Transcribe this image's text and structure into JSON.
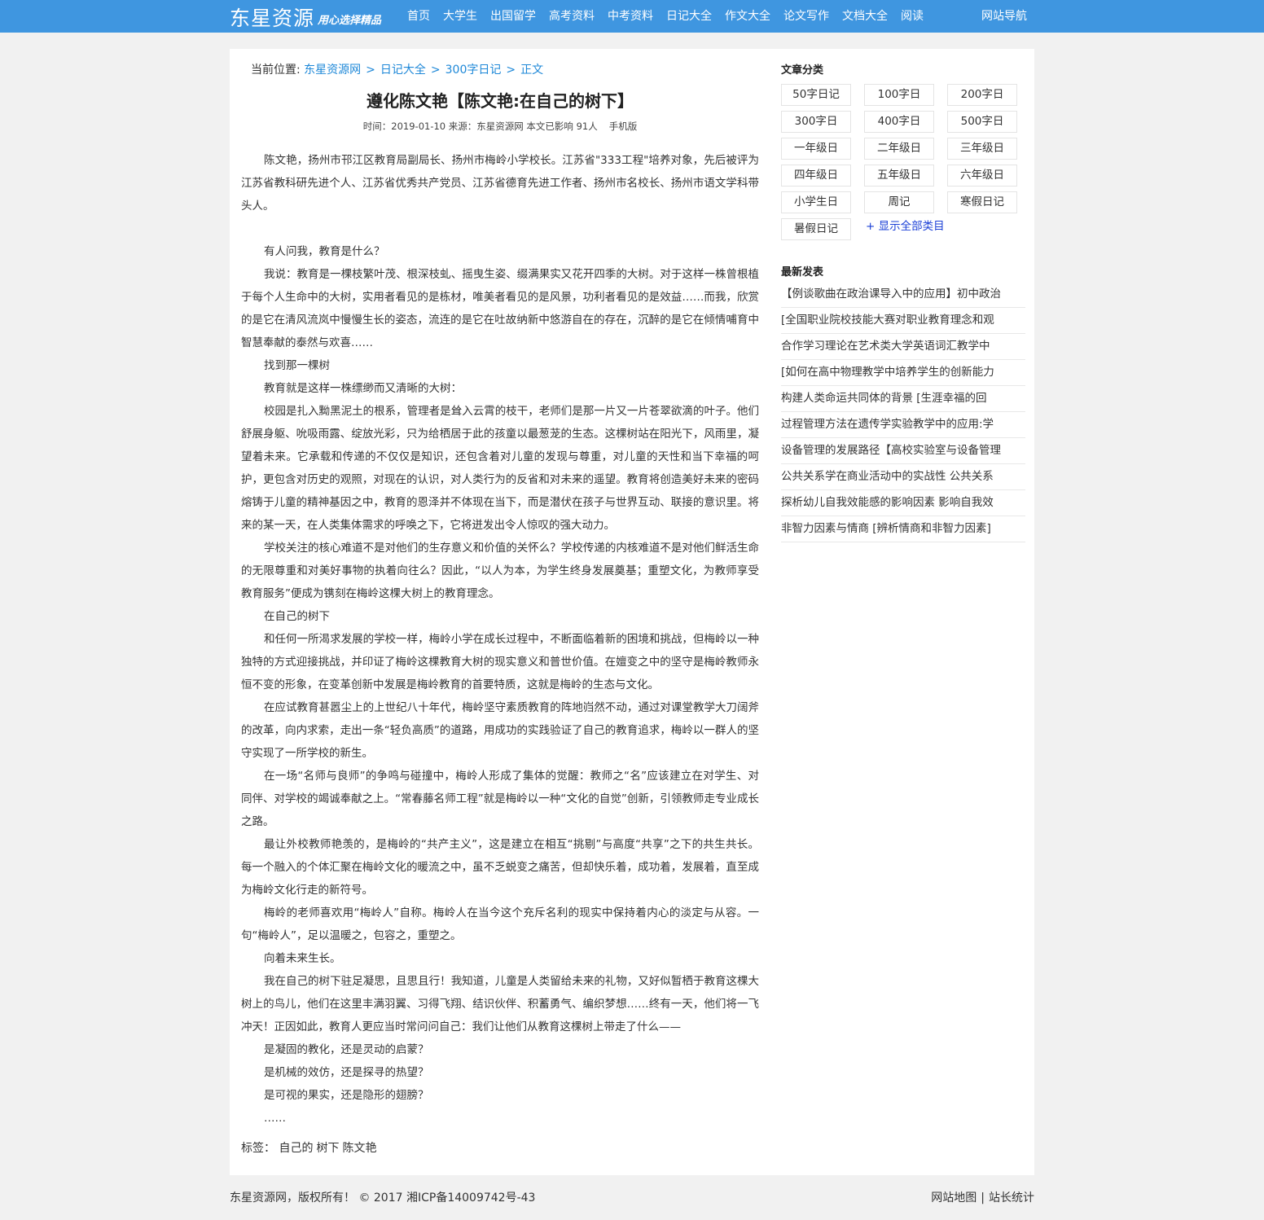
{
  "header": {
    "logo": "东星资源",
    "slogan": "用心选择精品",
    "nav": [
      "首页",
      "大学生",
      "出国留学",
      "高考资料",
      "中考资料",
      "日记大全",
      "作文大全",
      "论文写作",
      "文档大全",
      "阅读"
    ],
    "site_nav": "网站导航"
  },
  "breadcrumb": {
    "prefix": "当前位置:",
    "items": [
      "东星资源网",
      "日记大全",
      "300字日记",
      "正文"
    ],
    "separator": ">"
  },
  "article": {
    "title": "遵化陈文艳【陈文艳:在自己的树下】",
    "meta": "时间：2019-01-10 来源：东星资源网 本文已影响  91人",
    "mobile_link": "手机版",
    "paragraphs": [
      "陈文艳，扬州市邗江区教育局副局长、扬州市梅岭小学校长。江苏省\"333工程\"培养对象，先后被评为江苏省教科研先进个人、江苏省优秀共产党员、江苏省德育先进工作者、扬州市名校长、扬州市语文学科带头人。",
      "",
      "有人问我，教育是什么？",
      "我说：教育是一棵枝繁叶茂、根深枝虬、摇曳生姿、缀满果实又花开四季的大树。对于这样一株曾根植于每个人生命中的大树，实用者看见的是栋材，唯美者看见的是风景，功利者看见的是效益……而我，欣赏的是它在清风流岚中慢慢生长的姿态，流连的是它在吐故纳新中悠游自在的存在，沉醉的是它在倾情哺育中智慧奉献的泰然与欢喜……",
      "找到那一棵树",
      "教育就是这样一株缥缈而又清晰的大树：",
      "校园是扎入黝黑泥土的根系，管理者是耸入云霄的枝干，老师们是那一片又一片苍翠欲滴的叶子。他们舒展身躯、吮吸雨露、绽放光彩，只为给栖居于此的孩童以最葱茏的生态。这棵树站在阳光下，风雨里，凝望着未来。它承载和传递的不仅仅是知识，还包含着对儿童的发现与尊重，对儿童的天性和当下幸福的呵护，更包含对历史的观照，对现在的认识，对人类行为的反省和对未来的遥望。教育将创造美好未来的密码熔铸于儿童的精神基因之中，教育的恩泽并不体现在当下，而是潜伏在孩子与世界互动、联接的意识里。将来的某一天，在人类集体需求的呼唤之下，它将迸发出令人惊叹的强大动力。",
      "学校关注的核心难道不是对他们的生存意义和价值的关怀么？学校传递的内核难道不是对他们鲜活生命的无限尊重和对美好事物的执着向往么？因此，“以人为本，为学生终身发展奠基；重塑文化，为教师享受教育服务”便成为镌刻在梅岭这棵大树上的教育理念。",
      "在自己的树下",
      "和任何一所渴求发展的学校一样，梅岭小学在成长过程中，不断面临着新的困境和挑战，但梅岭以一种独特的方式迎接挑战，并印证了梅岭这棵教育大树的现实意义和普世价值。在嬗变之中的坚守是梅岭教师永恒不变的形象，在变革创新中发展是梅岭教育的首要特质，这就是梅岭的生态与文化。",
      "在应试教育甚嚣尘上的上世纪八十年代，梅岭坚守素质教育的阵地岿然不动，通过对课堂教学大刀阔斧的改革，向内求索，走出一条“轻负高质”的道路，用成功的实践验证了自己的教育追求，梅岭以一群人的坚守实现了一所学校的新生。",
      "在一场“名师与良师”的争鸣与碰撞中，梅岭人形成了集体的觉醒：教师之“名”应该建立在对学生、对同伴、对学校的竭诚奉献之上。“常春藤名师工程”就是梅岭以一种“文化的自觉”创新，引领教师走专业成长之路。",
      "最让外校教师艳羡的，是梅岭的“共产主义”，这是建立在相互“挑剔”与高度“共享”之下的共生共长。每一个融入的个体汇聚在梅岭文化的暖流之中，虽不乏蜕变之痛苦，但却快乐着，成功着，发展着，直至成为梅岭文化行走的新符号。",
      "梅岭的老师喜欢用“梅岭人”自称。梅岭人在当今这个充斥名利的现实中保持着内心的淡定与从容。一句“梅岭人”，足以温暖之，包容之，重塑之。",
      "向着未来生长。",
      "我在自己的树下驻足凝思，且思且行！我知道，儿童是人类留给未来的礼物，又好似暂栖于教育这棵大树上的鸟儿，他们在这里丰满羽翼、习得飞翔、结识伙伴、积蓄勇气、编织梦想……终有一天，他们将一飞冲天！正因如此，教育人更应当时常问问自己：我们让他们从教育这棵树上带走了什么——",
      "是凝固的教化，还是灵动的启蒙？",
      "是机械的效仿，还是探寻的热望？",
      "是可视的果实，还是隐形的翅膀？",
      "……"
    ],
    "tags_label": "标签：",
    "tags": [
      "自己的",
      "树下",
      "陈文艳"
    ]
  },
  "sidebar": {
    "category_title": "文章分类",
    "categories": [
      "50字日记",
      "100字日",
      "200字日",
      "300字日",
      "400字日",
      "500字日",
      "一年级日",
      "二年级日",
      "三年级日",
      "四年级日",
      "五年级日",
      "六年级日",
      "小学生日",
      "周记",
      "寒假日记",
      "暑假日记"
    ],
    "show_all": "+ 显示全部类目",
    "latest_title": "最新发表",
    "latest": [
      "【例谈歌曲在政治课导入中的应用】初中政治",
      "[全国职业院校技能大赛对职业教育理念和观",
      "合作学习理论在艺术类大学英语词汇教学中",
      "[如何在高中物理教学中培养学生的创新能力",
      "构建人类命运共同体的背景 [生涯幸福的回",
      "过程管理方法在遗传学实验教学中的应用:学",
      "设备管理的发展路径【高校实验室与设备管理",
      "公共关系学在商业活动中的实战性 公共关系",
      "探析幼儿自我效能感的影响因素 影响自我效",
      "非智力因素与情商 [辨析情商和非智力因素]"
    ]
  },
  "footer": {
    "copyright": "东星资源网，版权所有！ © 2017 湘ICP备14009742号-43",
    "links": [
      "网站地图",
      "站长统计"
    ],
    "divider": "|"
  }
}
